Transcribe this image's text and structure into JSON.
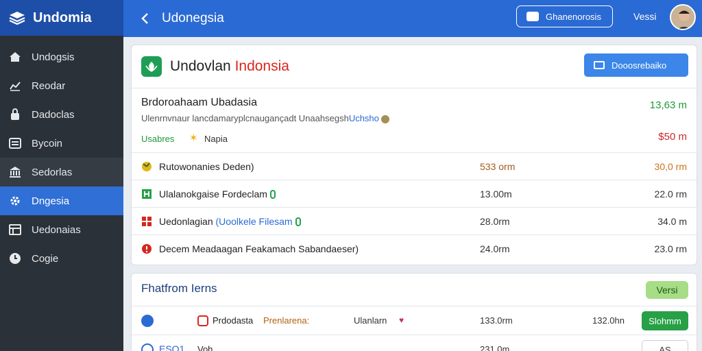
{
  "app": {
    "title": "Undomia"
  },
  "sidebar": {
    "items": [
      {
        "label": "Undogsis",
        "icon": "home-icon"
      },
      {
        "label": "Reodar",
        "icon": "chart-icon"
      },
      {
        "label": "Dadoclas",
        "icon": "lock-icon"
      },
      {
        "label": "Bycoin",
        "icon": "list-icon"
      },
      {
        "label": "Sedorlas",
        "icon": "bank-icon"
      },
      {
        "label": "Dngesia",
        "icon": "gear-icon"
      },
      {
        "label": "Uedonaias",
        "icon": "table-icon"
      },
      {
        "label": "Cogie",
        "icon": "clock-icon"
      }
    ],
    "active_index": 5
  },
  "topbar": {
    "title": "Udonegsia",
    "button_label": "Ghanenorosis",
    "user": "Vessi"
  },
  "card1": {
    "title_main": "Undovlan ",
    "title_red": "Indonsia",
    "action_label": "Dooosrebaiko",
    "summary": {
      "title": "Brdoroahaam Ubadasia",
      "subtitle": "Ulenrnvnaur lancdamaryplcnaugançadt Unaahsegsh",
      "subtitle_blue": "Uchsho",
      "tag": "Usabres",
      "place": "Napia",
      "value1": "13,63 m",
      "value2": "$50 m"
    },
    "rows": [
      {
        "label": "Rutowonanies Deden)",
        "label_extra": "",
        "mid": "533 orm",
        "right": "30,0 rm",
        "icon": "flower-icon"
      },
      {
        "label": "Ulalanokgaise Fordeclam",
        "label_extra": "",
        "mid": "13.00m",
        "right": "22.0 rm",
        "icon": "tree-icon"
      },
      {
        "label": "Uedonlagian ",
        "label_extra": "(Uoolkele Filesam",
        "mid": "28.0rm",
        "right": "34.0 m",
        "icon": "grid-icon"
      },
      {
        "label": "Decem Meadaagan Feakamach Sabandaeser)",
        "label_extra": "",
        "mid": "24.0rm",
        "right": "23.0 rm",
        "icon": "alert-icon"
      }
    ]
  },
  "card2": {
    "title": "Fhatfrom Ierns",
    "badge": "Versi",
    "rows": [
      {
        "t1": "Prdodasta",
        "t2": "Prenlarena:",
        "t3": "Ulanlarn",
        "num1": "133.0rm",
        "num2": "132.0hn",
        "button": "Slohmm"
      },
      {
        "blue": "ESQ1",
        "t1": "Voh",
        "num1": "231.0m",
        "button": "AS"
      }
    ]
  },
  "colors": {
    "sidebar": "#2b3138",
    "brand": "#1e4fa8",
    "topbar": "#2a6ad4",
    "active": "#2f6fd6",
    "green": "#1d9a3a",
    "red": "#c92a2a"
  }
}
